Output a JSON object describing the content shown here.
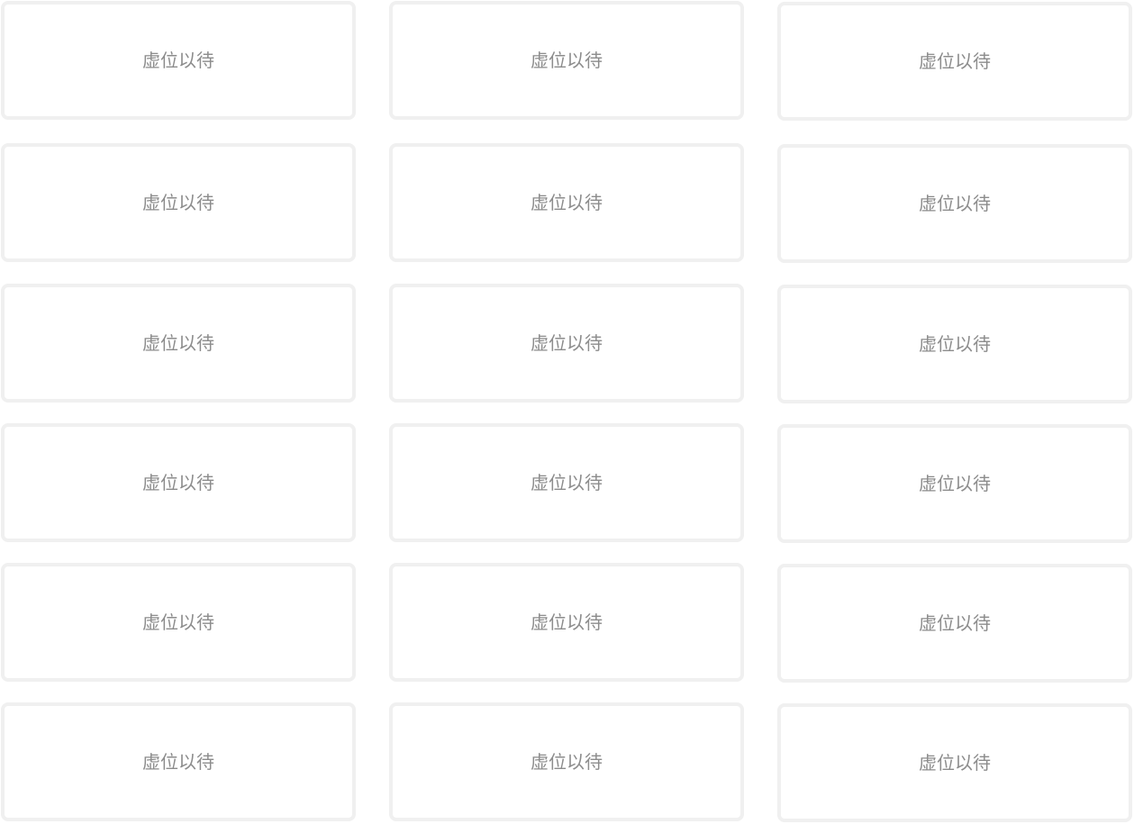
{
  "slots": {
    "placeholder_label": "虚位以待",
    "count": 18
  },
  "colors": {
    "background": "#ffffff",
    "card_border": "#f0f0f0",
    "label_text": "#8c8c8c"
  }
}
